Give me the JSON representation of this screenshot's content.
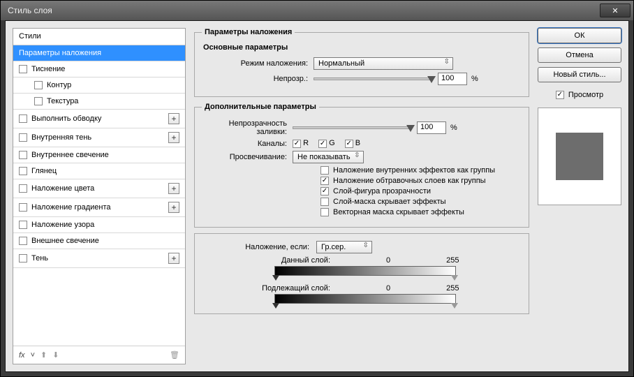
{
  "window": {
    "title": "Стиль слоя"
  },
  "buttons": {
    "ok": "ОК",
    "cancel": "Отмена",
    "new_style": "Новый стиль...",
    "preview": "Просмотр"
  },
  "styles_list": {
    "header": "Стили",
    "selected": "Параметры наложения",
    "items": [
      {
        "label": "Тиснение",
        "plus": false,
        "indent": 0
      },
      {
        "label": "Контур",
        "plus": false,
        "indent": 1
      },
      {
        "label": "Текстура",
        "plus": false,
        "indent": 1
      },
      {
        "label": "Выполнить обводку",
        "plus": true,
        "indent": 0
      },
      {
        "label": "Внутренняя тень",
        "plus": true,
        "indent": 0
      },
      {
        "label": "Внутреннее свечение",
        "plus": false,
        "indent": 0
      },
      {
        "label": "Глянец",
        "plus": false,
        "indent": 0
      },
      {
        "label": "Наложение цвета",
        "plus": true,
        "indent": 0
      },
      {
        "label": "Наложение градиента",
        "plus": true,
        "indent": 0
      },
      {
        "label": "Наложение узора",
        "plus": false,
        "indent": 0
      },
      {
        "label": "Внешнее свечение",
        "plus": false,
        "indent": 0
      },
      {
        "label": "Тень",
        "plus": true,
        "indent": 0
      }
    ],
    "footer_fx": "fx"
  },
  "blending": {
    "group_title": "Параметры наложения",
    "main_title": "Основные параметры",
    "mode_label": "Режим наложения:",
    "mode_value": "Нормальный",
    "opacity_label": "Непрозр.:",
    "opacity_value": "100",
    "pct": "%",
    "adv_title": "Дополнительные параметры",
    "fill_label": "Непрозрачность заливки:",
    "fill_value": "100",
    "channels_label": "Каналы:",
    "ch_r": "R",
    "ch_g": "G",
    "ch_b": "B",
    "knockout_label": "Просвечивание:",
    "knockout_value": "Не показывать",
    "opt1": "Наложение внутренних эффектов как группы",
    "opt2": "Наложение обтравочных слоев как группы",
    "opt3": "Слой-фигура прозрачности",
    "opt4": "Слой-маска скрывает эффекты",
    "opt5": "Векторная маска скрывает эффекты",
    "blendif_label": "Наложение, если:",
    "blendif_value": "Гр.сер.",
    "this_layer": "Данный слой:",
    "under_layer": "Подлежащий слой:",
    "v0": "0",
    "v255": "255"
  }
}
